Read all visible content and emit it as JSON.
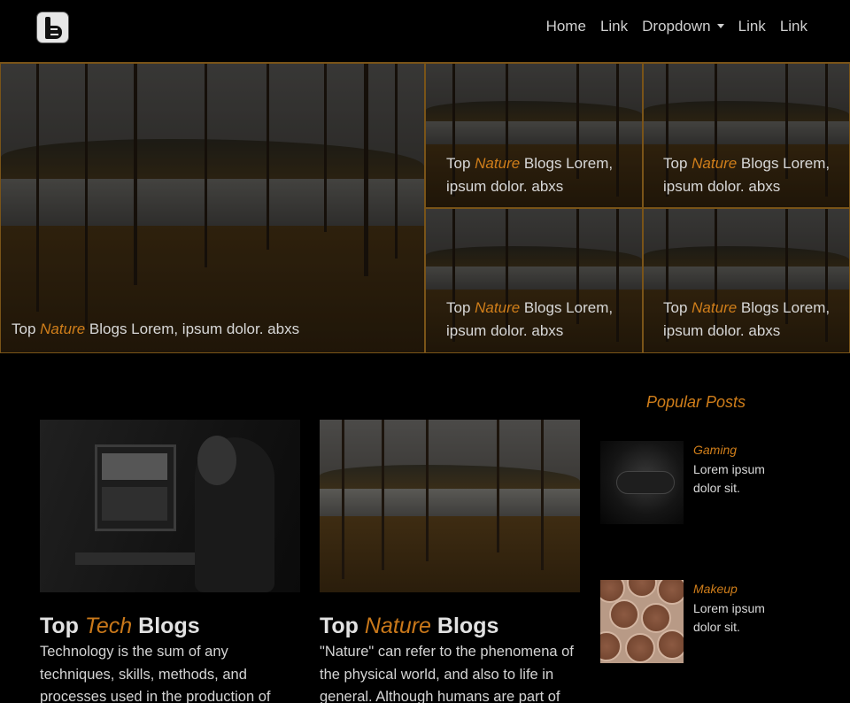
{
  "navbar": {
    "logo_icon": "blogger-logo",
    "links": [
      "Home",
      "Link",
      "Dropdown",
      "Link",
      "Link"
    ]
  },
  "hero": {
    "tiles": [
      {
        "prefix": "Top",
        "accent": "Nature",
        "suffix": "Blogs Lorem, ipsum dolor. abxs"
      },
      {
        "prefix": "Top",
        "accent": "Nature",
        "suffix": "Blogs Lorem, ipsum dolor. abxs"
      },
      {
        "prefix": "Top",
        "accent": "Nature",
        "suffix": "Blogs Lorem, ipsum dolor. abxs"
      },
      {
        "prefix": "Top",
        "accent": "Nature",
        "suffix": "Blogs Lorem, ipsum dolor. abxs"
      },
      {
        "prefix": "Top",
        "accent": "Nature",
        "suffix": "Blogs Lorem, ipsum dolor. abxs"
      }
    ]
  },
  "main": {
    "cards": [
      {
        "prefix": "Top",
        "accent": "Tech",
        "suffix": "Blogs",
        "text": "Technology is the sum of any techniques, skills, methods, and processes used in the production of"
      },
      {
        "prefix": "Top",
        "accent": "Nature",
        "suffix": "Blogs",
        "text": "\"Nature\" can refer to the phenomena of the physical world, and also to life in general. Although humans are part of"
      }
    ]
  },
  "sidebar": {
    "title": "Popular Posts",
    "posts": [
      {
        "category": "Gaming",
        "text": "Lorem ipsum dolor sit."
      },
      {
        "category": "Makeup",
        "text": "Lorem ipsum dolor sit."
      }
    ]
  },
  "colors": {
    "accent": "#d07e1a",
    "background": "#000000",
    "border": "#7a5418"
  }
}
